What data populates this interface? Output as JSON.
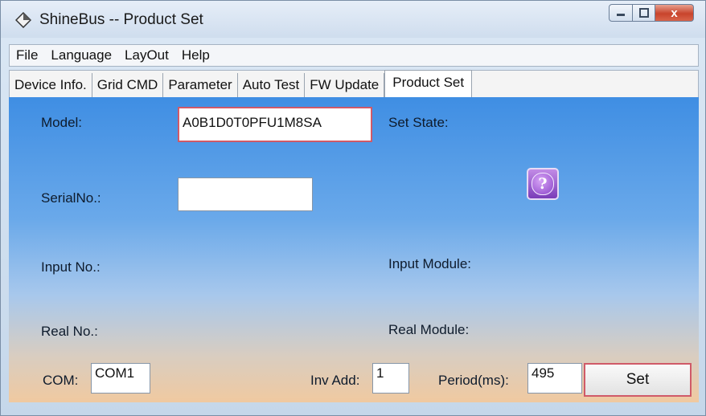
{
  "window": {
    "title": "ShineBus -- Product Set",
    "icon": "diamond-app-icon",
    "controls": {
      "minimize": "minimize-icon",
      "maximize": "maximize-icon",
      "close": "x"
    }
  },
  "menu": {
    "items": [
      {
        "label": "File"
      },
      {
        "label": "Language"
      },
      {
        "label": "LayOut"
      },
      {
        "label": "Help"
      }
    ]
  },
  "tabs": [
    {
      "label": "Device Info.",
      "active": false
    },
    {
      "label": "Grid CMD",
      "active": false
    },
    {
      "label": "Parameter",
      "active": false
    },
    {
      "label": "Auto Test",
      "active": false
    },
    {
      "label": "FW Update",
      "active": false
    },
    {
      "label": "Product Set",
      "active": true
    }
  ],
  "form": {
    "model_label": "Model:",
    "model_value": "A0B1D0T0PFU1M8SA",
    "set_state_label": "Set State:",
    "serial_label": "SerialNo.:",
    "serial_value": "",
    "input_no_label": "Input No.:",
    "input_module_label": "Input Module:",
    "real_no_label": "Real No.:",
    "real_module_label": "Real Module:",
    "com_label": "COM:",
    "com_value": "COM1",
    "inv_add_label": "Inv Add:",
    "inv_add_value": "1",
    "period_label": "Period(ms):",
    "period_value": "495",
    "set_button": "Set",
    "help_icon": "question-mark-icon",
    "help_glyph": "?"
  },
  "colors": {
    "panel_top": "#3f8ee3",
    "panel_bottom": "#f0c9a0",
    "focus_border": "#d05a68",
    "help_button": "#8c45c9",
    "close_button": "#c8442c"
  }
}
